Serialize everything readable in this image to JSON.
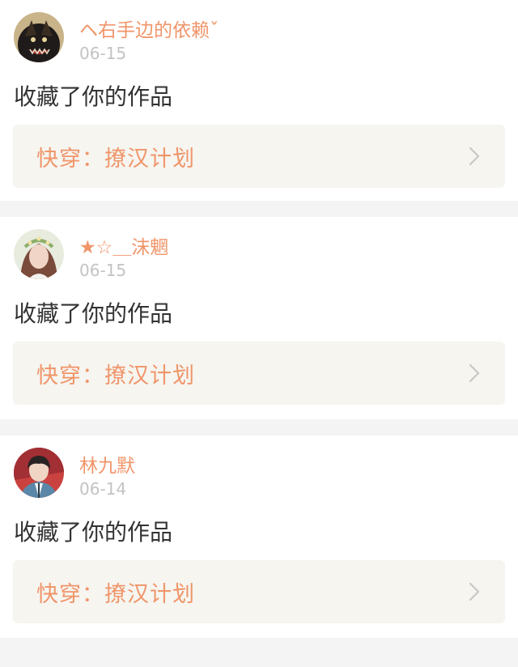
{
  "notifications": [
    {
      "username": "ヘ右手边的依赖ˇ",
      "date": "06-15",
      "action": "收藏了你的作品",
      "work_title": "快穿：撩汉计划",
      "avatar": "avatar-dark-creature"
    },
    {
      "username": "★☆＿沫魍",
      "date": "06-15",
      "action": "收藏了你的作品",
      "work_title": "快穿：撩汉计划",
      "avatar": "avatar-girl-flower-crown"
    },
    {
      "username": "林九默",
      "date": "06-14",
      "action": "收藏了你的作品",
      "work_title": "快穿：撩汉计划",
      "avatar": "avatar-boy-denim"
    }
  ],
  "colors": {
    "accent": "#f0956a",
    "muted": "#c3c3c3",
    "card_link_bg": "#f6f5f0",
    "separator": "#f4f4f4"
  },
  "icons": {
    "chevron": "chevron-right-icon"
  }
}
